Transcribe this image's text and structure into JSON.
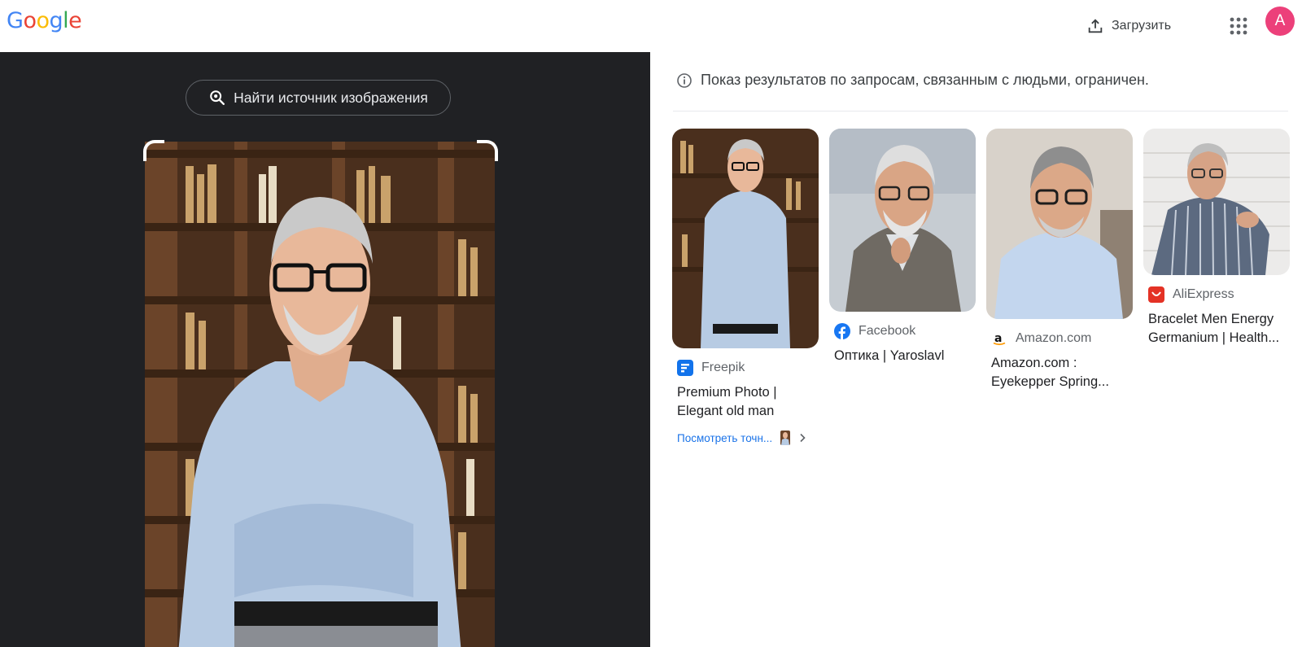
{
  "header": {
    "logo": "Google",
    "upload_label": "Загрузить",
    "avatar_letter": "A",
    "colors": {
      "blue": "#4285F4",
      "red": "#EA4335",
      "yellow": "#FBBC05",
      "green": "#34A853"
    }
  },
  "left": {
    "find_source_label": "Найти источник изображения"
  },
  "notice": "Показ результатов по запросам, связанным с людьми, ограничен.",
  "results": [
    {
      "source": "Freepik",
      "title": "Premium Photo | Elegant old man",
      "see_more": "Посмотреть точн...",
      "icon": "freepik-icon"
    },
    {
      "source": "Facebook",
      "title": "Оптика | Yaroslavl",
      "icon": "facebook-icon"
    },
    {
      "source": "Amazon.com",
      "title": "Amazon.com : Eyekepper Spring...",
      "icon": "amazon-icon"
    },
    {
      "source": "AliExpress",
      "title": "Bracelet Men Energy Germanium | Health...",
      "icon": "aliexpress-icon"
    }
  ]
}
